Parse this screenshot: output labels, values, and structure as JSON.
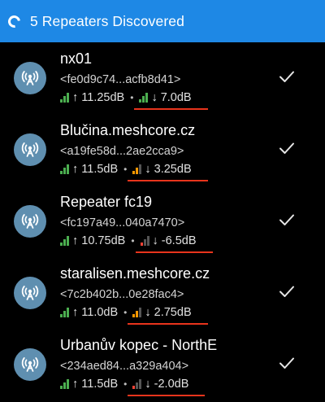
{
  "header": {
    "title": "5 Repeaters Discovered",
    "color": "#1E88E5"
  },
  "colors": {
    "green": "#4CAF50",
    "orange": "#FF9800",
    "red": "#F44336",
    "dim": "#555555",
    "underline": "#E8341C"
  },
  "repeaters": [
    {
      "name": "nx01",
      "key": "<fe0d9c74...acfb8d41>",
      "tx": "↑ 11.25dB",
      "rx": "↓ 7.0dB",
      "tx_bars": [
        "green",
        "green",
        "green"
      ],
      "rx_bars": [
        "green",
        "green",
        "green"
      ],
      "icon": "antenna-icon",
      "selected": true
    },
    {
      "name": "Blučina.meshcore.cz",
      "key": "<a19fe58d...2ae2cca9>",
      "tx": "↑ 11.5dB",
      "rx": "↓ 3.25dB",
      "tx_bars": [
        "green",
        "green",
        "green"
      ],
      "rx_bars": [
        "orange",
        "orange",
        "dim"
      ],
      "icon": "antenna-icon",
      "selected": true
    },
    {
      "name": "Repeater fc19",
      "key": "<fc197a49...040a7470>",
      "tx": "↑ 10.75dB",
      "rx": "↓ -6.5dB",
      "tx_bars": [
        "green",
        "green",
        "green"
      ],
      "rx_bars": [
        "red",
        "dim",
        "dim"
      ],
      "icon": "antenna-icon",
      "selected": true
    },
    {
      "name": "staralisen.meshcore.cz",
      "key": "<7c2b402b...0e28fac4>",
      "tx": "↑ 11.0dB",
      "rx": "↓ 2.75dB",
      "tx_bars": [
        "green",
        "green",
        "green"
      ],
      "rx_bars": [
        "orange",
        "orange",
        "dim"
      ],
      "icon": "antenna-icon",
      "selected": true
    },
    {
      "name": "Urbanův kopec - NorthE",
      "key": "<234aed84...a329a404>",
      "tx": "↑ 11.5dB",
      "rx": "↓ -2.0dB",
      "tx_bars": [
        "green",
        "green",
        "green"
      ],
      "rx_bars": [
        "red",
        "dim",
        "dim"
      ],
      "icon": "antenna-icon",
      "selected": true
    }
  ]
}
